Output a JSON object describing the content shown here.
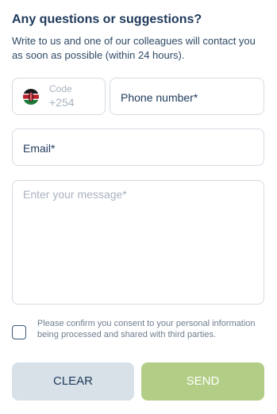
{
  "header": {
    "title": "Any questions or suggestions?",
    "subtitle": "Write to us and one of our colleagues will contact you as soon as possible (within 24 hours)."
  },
  "form": {
    "country_code": {
      "label": "Code",
      "value": "+254",
      "flag_icon": "kenya-flag-icon"
    },
    "phone": {
      "label": "Phone number*"
    },
    "email": {
      "label": "Email*"
    },
    "message": {
      "placeholder": "Enter your message*"
    },
    "consent": {
      "text": "Please confirm you consent to your personal information being processed and shared with third parties.",
      "checked": false
    }
  },
  "buttons": {
    "clear_label": "CLEAR",
    "send_label": "SEND"
  },
  "colors": {
    "title": "#1f3a5c",
    "send_button": "#b2ce86",
    "clear_button": "#d9e1e8",
    "border": "#d5dbe3",
    "placeholder": "#a9b3bf"
  }
}
